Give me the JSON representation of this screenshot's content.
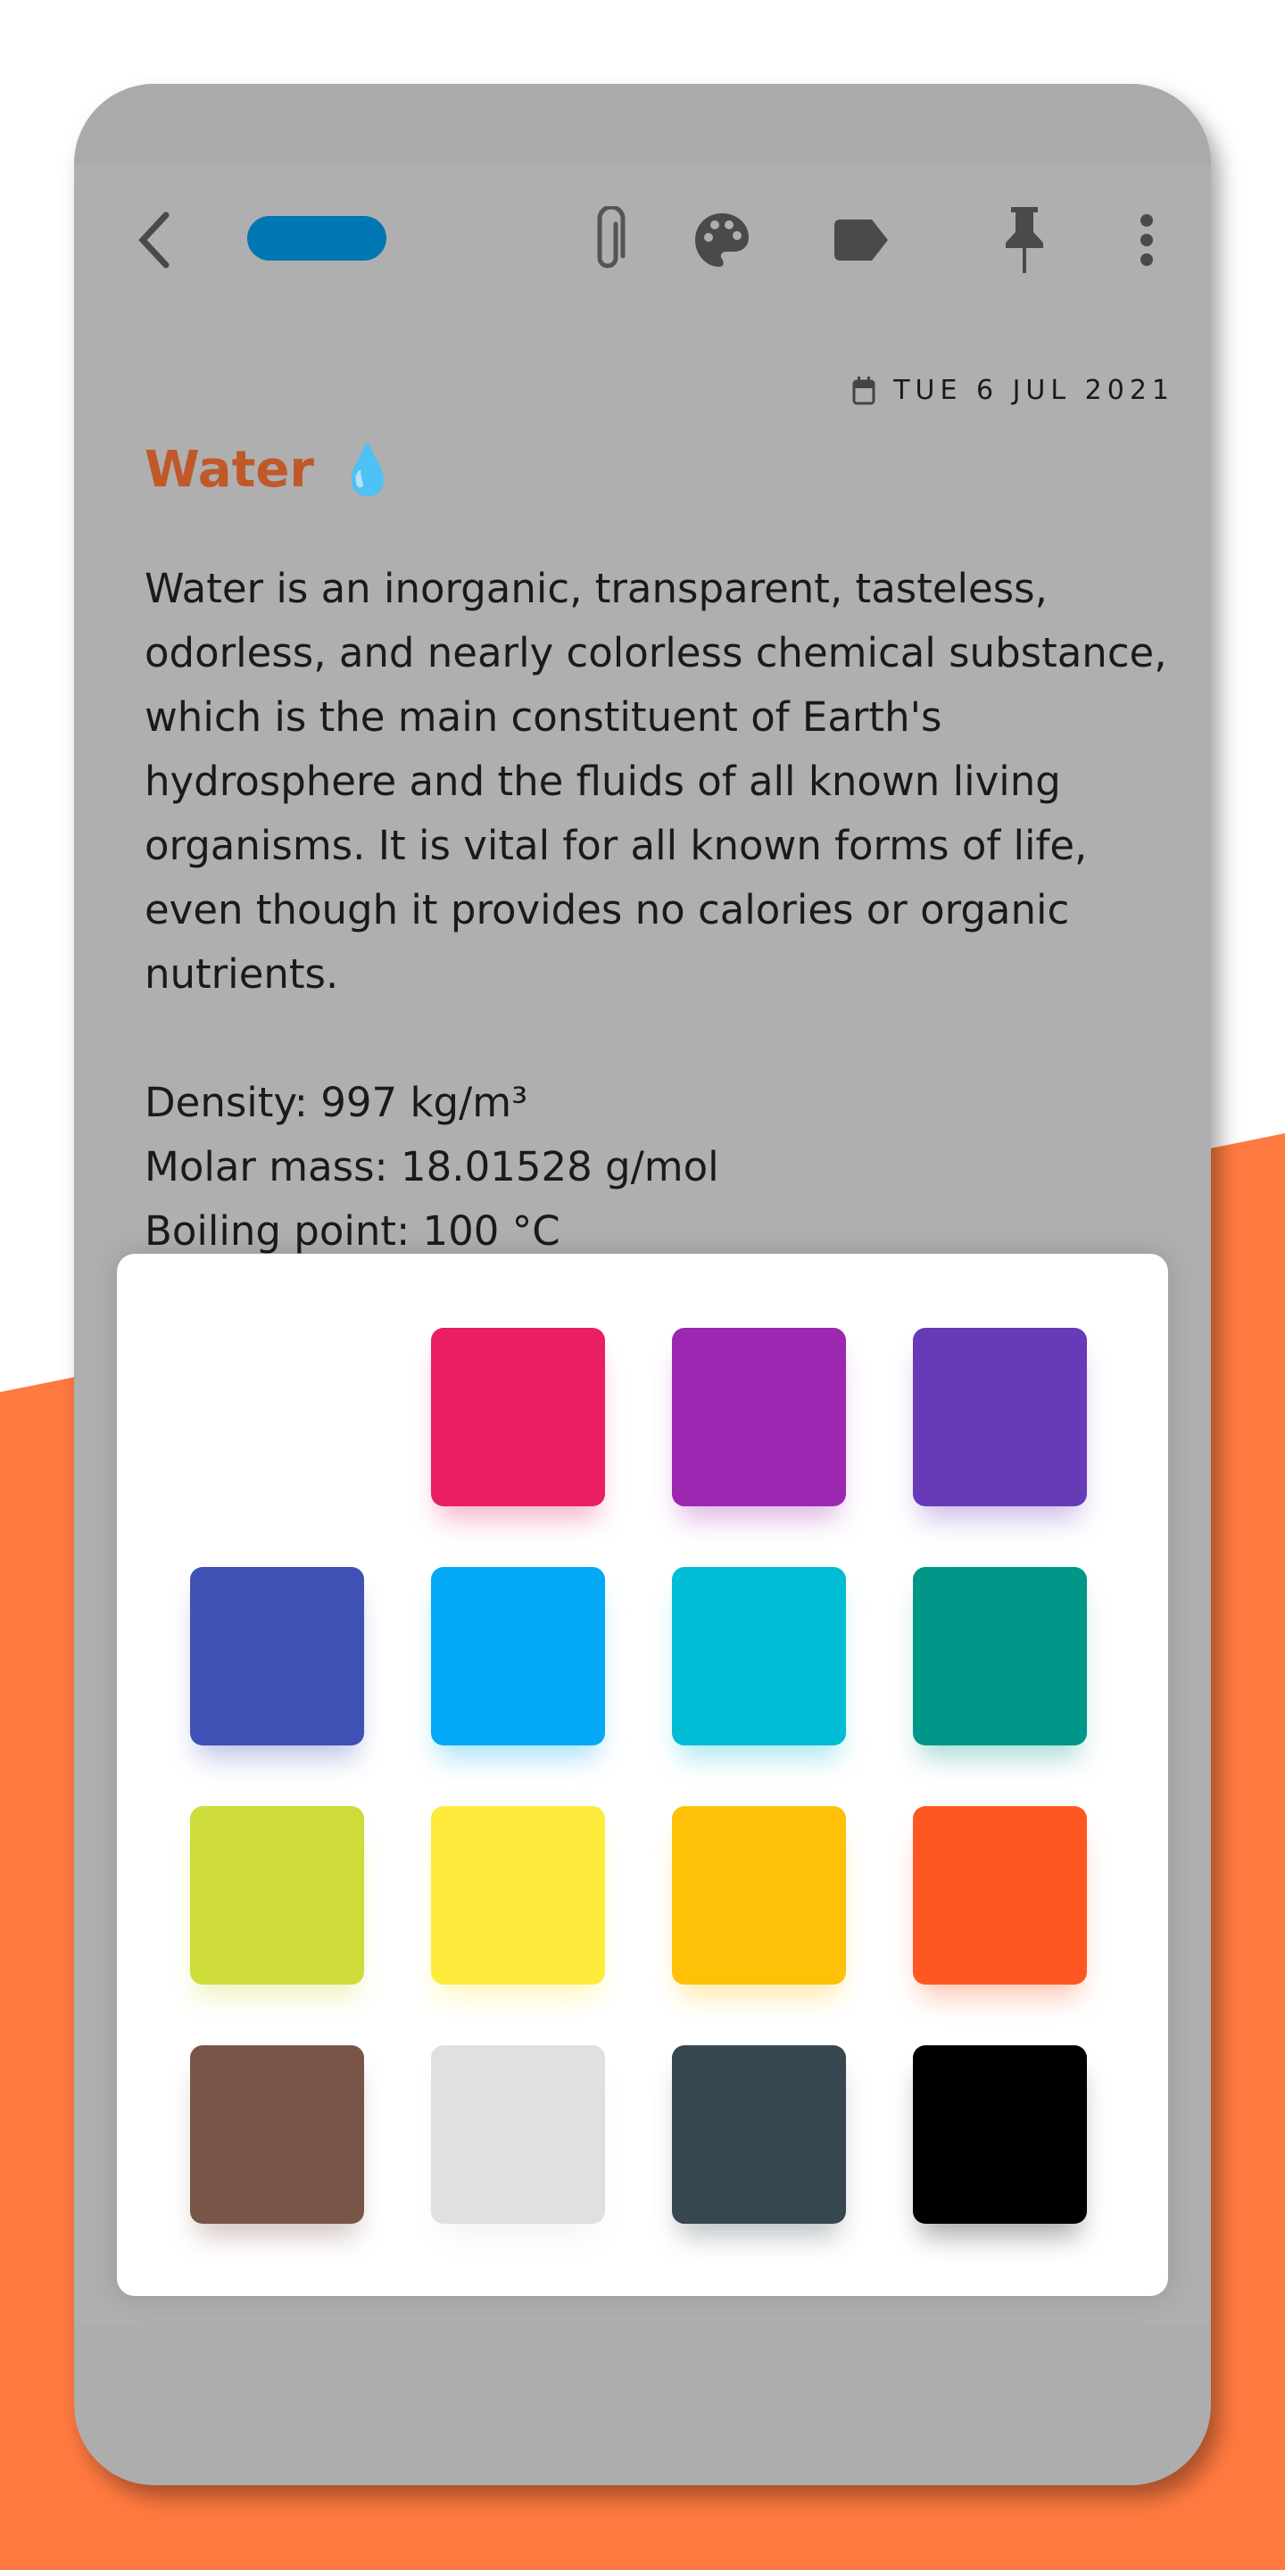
{
  "background": {
    "accent": "#ff7a40"
  },
  "toolbar": {
    "back_icon": "chevron-left",
    "pill_color": "#0077b3",
    "icons": [
      "paperclip",
      "palette",
      "label",
      "pin",
      "more-vertical"
    ]
  },
  "note": {
    "date": "TUE 6 JUL 2021",
    "title": "Water",
    "title_emoji": "💧",
    "title_color": "#c0582a",
    "body": "Water is an inorganic, transparent, tasteless, odorless, and nearly colorless chemical substance, which is the main constituent of Earth's hydrosphere and the fluids of all known living organisms. It is vital for all known forms of life, even though it provides no calories or organic nutrients.\n\nDensity: 997 kg/m³\nMolar mass: 18.01528 g/mol\nBoiling point: 100 °C"
  },
  "palette": {
    "colors": [
      "#ffffff",
      "#e91e63",
      "#9c27b0",
      "#673ab7",
      "#3f51b5",
      "#03a9f4",
      "#00bcd4",
      "#009688",
      "#cddc39",
      "#ffeb3b",
      "#ffc107",
      "#ff5722",
      "#795548",
      "#e0e0e0",
      "#37474f",
      "#000000"
    ]
  }
}
